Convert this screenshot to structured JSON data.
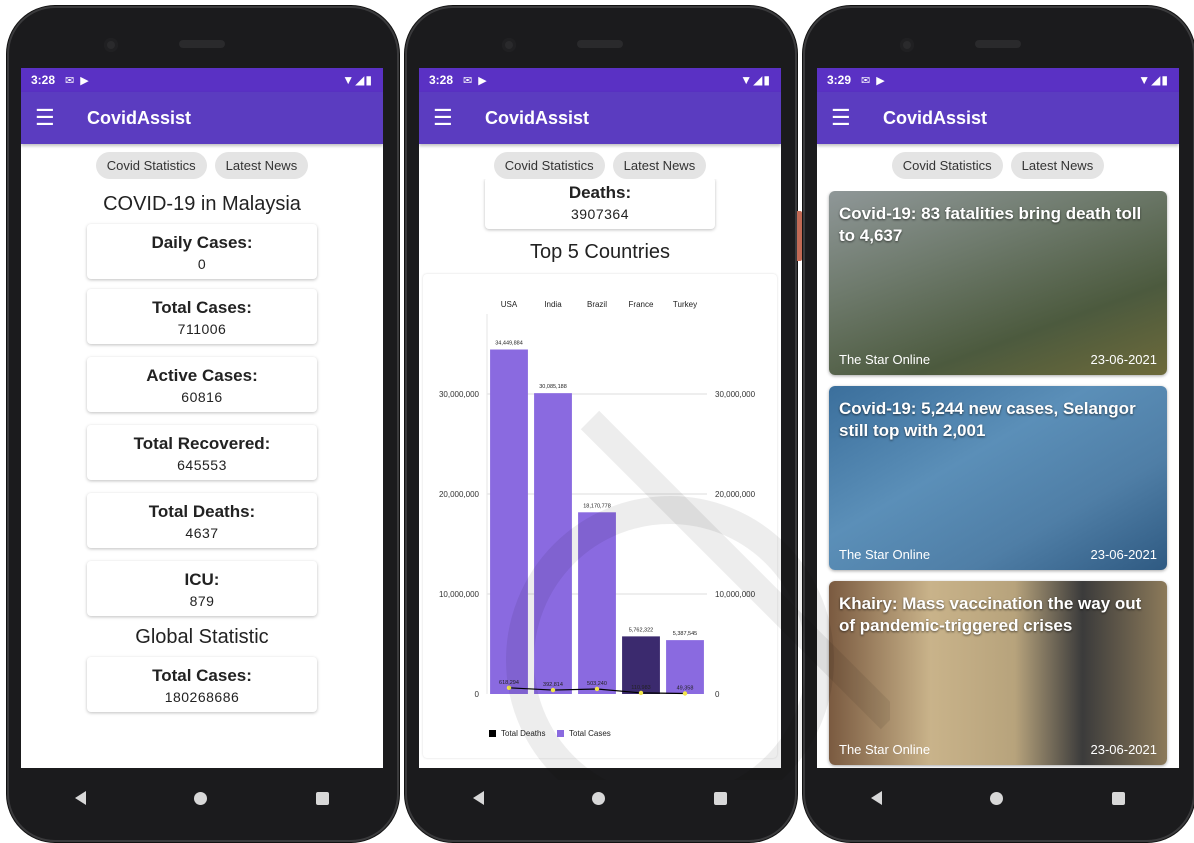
{
  "phones": [
    {
      "status": {
        "time": "3:28"
      },
      "app_title": "CovidAssist",
      "tabs": [
        "Covid Statistics",
        "Latest News"
      ],
      "malaysia_title": "COVID-19 in Malaysia",
      "stats": [
        {
          "label": "Daily Cases:",
          "value": "0"
        },
        {
          "label": "Total Cases:",
          "value": "711006"
        },
        {
          "label": "Active Cases:",
          "value": "60816"
        },
        {
          "label": "Total Recovered:",
          "value": "645553"
        },
        {
          "label": "Total Deaths:",
          "value": "4637"
        },
        {
          "label": "ICU:",
          "value": "879"
        }
      ],
      "global_title": "Global Statistic",
      "global_stats": [
        {
          "label": "Total Cases:",
          "value": "180268686"
        }
      ]
    },
    {
      "status": {
        "time": "3:28"
      },
      "app_title": "CovidAssist",
      "tabs": [
        "Covid Statistics",
        "Latest News"
      ],
      "deaths_card": {
        "label": "Deaths:",
        "value": "3907364"
      },
      "chart_title": "Top 5 Countries"
    },
    {
      "status": {
        "time": "3:29"
      },
      "app_title": "CovidAssist",
      "tabs": [
        "Covid Statistics",
        "Latest News"
      ],
      "news": [
        {
          "title": "Covid-19: 83 fatalities bring death toll to 4,637",
          "source": "The Star Online",
          "date": "23-06-2021"
        },
        {
          "title": "Covid-19: 5,244 new cases, Selangor still top with 2,001",
          "source": "The Star Online",
          "date": "23-06-2021"
        },
        {
          "title": "Khairy: Mass vaccination the way out of pandemic-triggered crises",
          "source": "The Star Online",
          "date": "23-06-2021"
        }
      ]
    }
  ],
  "colors": {
    "status_bar": "#5a31c4",
    "app_bar": "#5b3cc0",
    "bar": "#8a6ae0",
    "bar_dark": "#3b2a6e",
    "line": "#000000",
    "point": "#f2e64a"
  },
  "chart_data": {
    "type": "bar",
    "categories": [
      "USA",
      "India",
      "Brazil",
      "France",
      "Turkey"
    ],
    "series": [
      {
        "name": "Total Deaths",
        "type": "line",
        "values": [
          618294,
          392814,
          503240,
          110983,
          49358
        ],
        "labels": [
          "618,294",
          "392,814",
          "503,240",
          "110,983",
          "49,358"
        ]
      },
      {
        "name": "Total Cases",
        "type": "bar",
        "values": [
          34449884,
          30085188,
          18170778,
          5762322,
          5387545
        ],
        "labels": [
          "34,449,884",
          "30,085,188",
          "18,170,778",
          "5,762,322",
          "5,387,545"
        ]
      }
    ],
    "ylim": [
      0,
      38000000
    ],
    "yticks": [
      0,
      10000000,
      20000000,
      30000000
    ],
    "ytick_labels": [
      "0",
      "10,000,000",
      "20,000,000",
      "30,000,000"
    ],
    "legend": "bottom",
    "grid": true
  }
}
